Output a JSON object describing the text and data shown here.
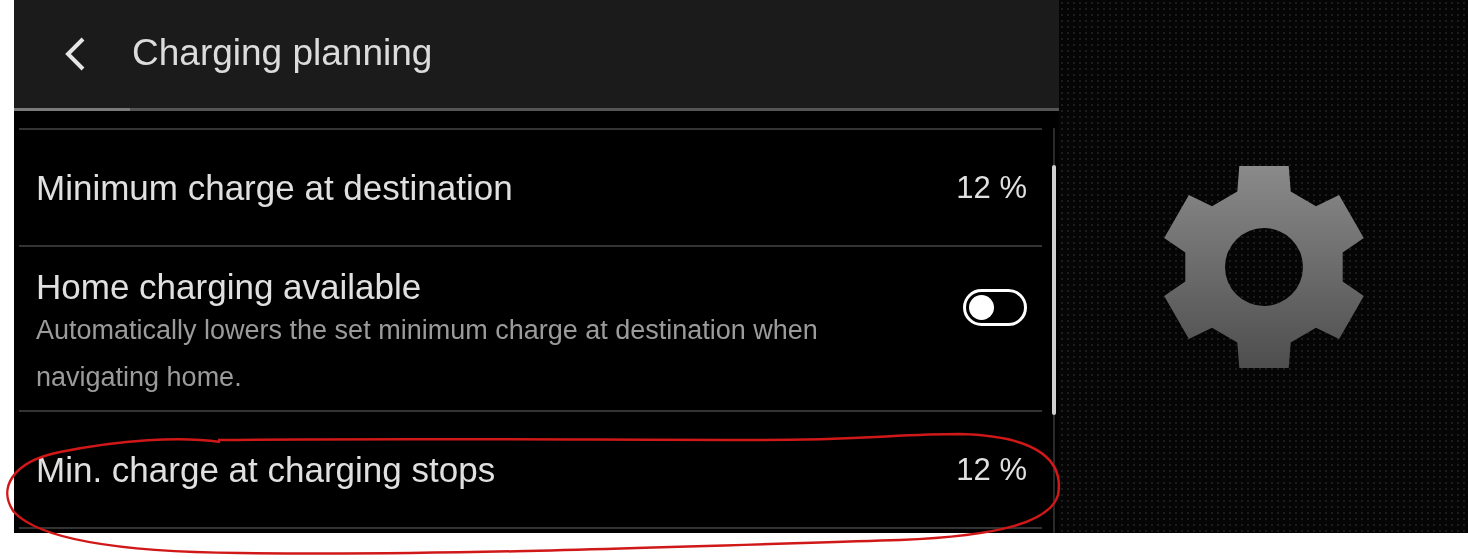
{
  "header": {
    "title": "Charging planning"
  },
  "settings": [
    {
      "kind": "value",
      "label": "Minimum charge at destination",
      "value": "12 %"
    },
    {
      "kind": "toggle",
      "label": "Home charging available",
      "description": "Automatically lowers the set minimum charge at destination when navigating home.",
      "on": false
    },
    {
      "kind": "value",
      "label": "Min. charge at charging stops",
      "value": "12 %"
    }
  ],
  "annotations": [
    {
      "kind": "freehand-circle",
      "color": "#d01818"
    }
  ]
}
